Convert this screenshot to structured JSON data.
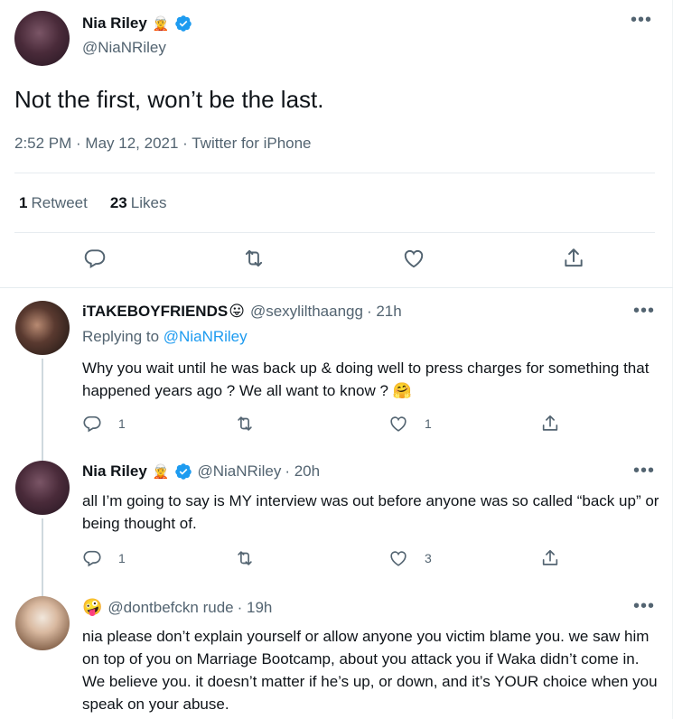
{
  "main_tweet": {
    "author_name": "Nia Riley",
    "author_emoji": "🧝",
    "handle": "@NiaNRiley",
    "text": "Not the first, won’t be the last.",
    "meta": "2:52 PM · May 12, 2021 · Twitter for iPhone",
    "stats": {
      "retweets_count": "1",
      "retweets_label": "Retweet",
      "likes_count": "23",
      "likes_label": "Likes"
    },
    "more_label": "•••"
  },
  "replies": [
    {
      "author_name": "iTAKEBOYFRIENDS",
      "author_emoji": "😛",
      "handle": "@sexylilthaangg",
      "time": "· 21h",
      "replying_prefix": "Replying to",
      "replying_handle": "@NiaNRiley",
      "text": "Why you wait until he was back up & doing well to press charges for something that happened years ago ? We all want to know ? 🤗",
      "reply_count": "1",
      "retweet_count": "",
      "like_count": "1",
      "more_label": "•••"
    },
    {
      "author_name": "Nia Riley",
      "author_emoji": "🧝",
      "handle": "@NiaNRiley",
      "time": "· 20h",
      "text": "all I’m going to say is MY interview was out before anyone was so called “back up” or being thought of.",
      "reply_count": "1",
      "retweet_count": "",
      "like_count": "3",
      "more_label": "•••"
    },
    {
      "author_name": "🤪",
      "handle": "@dontbefckn rude",
      "time": "· 19h",
      "text": "nia please don’t explain yourself or allow anyone you victim blame you. we saw him on top of you on Marriage Bootcamp, about you attack you if Waka didn’t come in. We believe you. it doesn’t matter if he’s up, or down, and  it’s YOUR choice when you speak on your abuse.",
      "more_label": "•••"
    }
  ],
  "colors": {
    "accent": "#1d9bf0",
    "secondary_text": "#536471",
    "primary_text": "#0f1419",
    "divider": "#e6ecf0",
    "thread_line": "#cfd9de"
  }
}
